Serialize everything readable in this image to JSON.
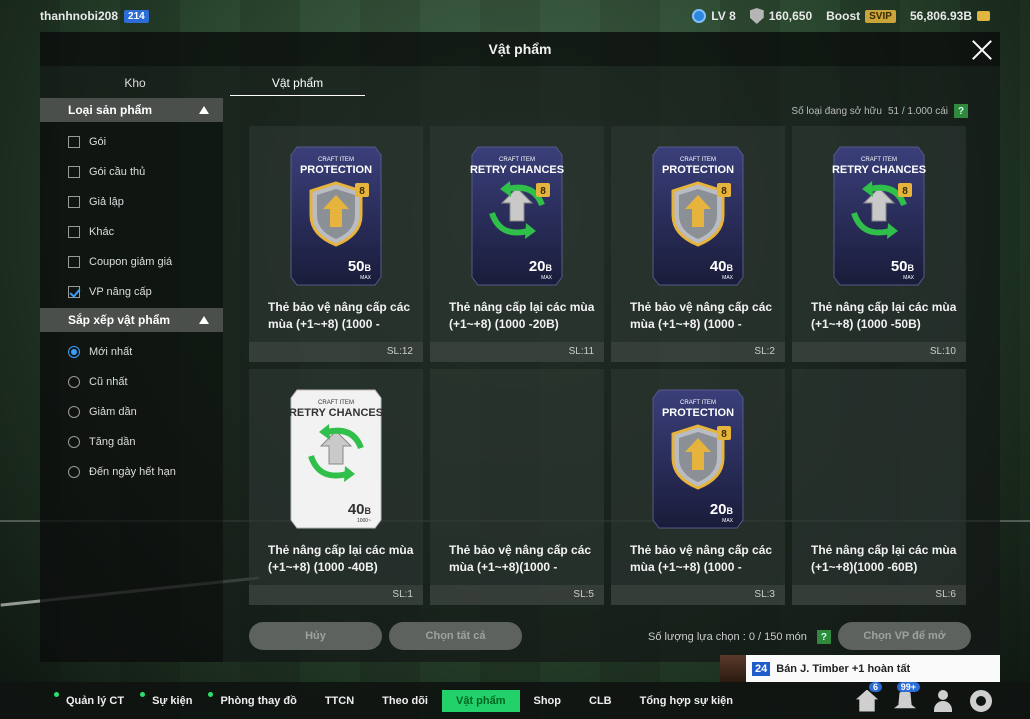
{
  "topbar": {
    "username": "thanhnobi208",
    "user_badge": "214",
    "level": "LV 8",
    "team_value": "160,650",
    "boost_label": "Boost",
    "vip_badge": "SVIP",
    "balance": "56,806.93B"
  },
  "modal": {
    "title": "Vật phẩm",
    "tabs": [
      {
        "label": "Kho",
        "active": false
      },
      {
        "label": "Vật phẩm",
        "active": true
      }
    ]
  },
  "sidebar": {
    "category_header": "Loại sản phẩm",
    "categories": [
      {
        "label": "Gói",
        "checked": false
      },
      {
        "label": "Gói cầu thủ",
        "checked": false
      },
      {
        "label": "Giả lập",
        "checked": false
      },
      {
        "label": "Khác",
        "checked": false
      },
      {
        "label": "Coupon giảm giá",
        "checked": false
      },
      {
        "label": "VP nâng cấp",
        "checked": true
      }
    ],
    "sort_header": "Sắp xếp vật phẩm",
    "sort_options": [
      {
        "label": "Mới nhất",
        "selected": true
      },
      {
        "label": "Cũ nhất",
        "selected": false
      },
      {
        "label": "Giảm dần",
        "selected": false
      },
      {
        "label": "Tăng dần",
        "selected": false
      },
      {
        "label": "Đến ngày hết hạn",
        "selected": false
      }
    ]
  },
  "owned": {
    "label": "Số loại đang sở hữu",
    "value": "51 / 1.000 cái",
    "help": "?"
  },
  "items": [
    {
      "type": "PROTECTION",
      "craft": "CRAFT ITEM",
      "value": "50",
      "unit": "B",
      "sub": "MAX",
      "name": "Thẻ bảo vệ nâng cấp các mùa (+1~+8) (1000 -",
      "qty": "SL:12",
      "style": "dark",
      "level": "8"
    },
    {
      "type": "RETRY CHANCES",
      "craft": "CRAFT ITEM",
      "value": "20",
      "unit": "B",
      "sub": "MAX",
      "name": "Thẻ nâng cấp lại các mùa (+1~+8) (1000 -20B)",
      "qty": "SL:11",
      "style": "dark",
      "level": "8"
    },
    {
      "type": "PROTECTION",
      "craft": "CRAFT ITEM",
      "value": "40",
      "unit": "B",
      "sub": "MAX",
      "name": "Thẻ bảo vệ nâng cấp các mùa (+1~+8) (1000 -",
      "qty": "SL:2",
      "style": "dark",
      "level": "8"
    },
    {
      "type": "RETRY CHANCES",
      "craft": "CRAFT ITEM",
      "value": "50",
      "unit": "B",
      "sub": "MAX",
      "name": "Thẻ nâng cấp lại các mùa (+1~+8) (1000 -50B)",
      "qty": "SL:10",
      "style": "dark",
      "level": "8"
    },
    {
      "type": "RETRY CHANCES",
      "craft": "CRAFT ITEM",
      "value": "40",
      "unit": "B",
      "sub": "1000~",
      "name": "Thẻ nâng cấp lại các mùa (+1~+8) (1000 -40B)",
      "qty": "SL:1",
      "style": "light",
      "level": ""
    },
    {
      "type": "",
      "craft": "",
      "value": "",
      "unit": "",
      "sub": "",
      "name": "Thẻ bảo vệ nâng cấp các mùa (+1~+8)(1000 -",
      "qty": "SL:5",
      "style": "none",
      "level": ""
    },
    {
      "type": "PROTECTION",
      "craft": "CRAFT ITEM",
      "value": "20",
      "unit": "B",
      "sub": "MAX",
      "name": "Thẻ bảo vệ nâng cấp các mùa (+1~+8) (1000 -",
      "qty": "SL:3",
      "style": "dark",
      "level": "8"
    },
    {
      "type": "",
      "craft": "",
      "value": "",
      "unit": "",
      "sub": "",
      "name": "Thẻ nâng cấp lại các mùa (+1~+8)(1000 -60B)",
      "qty": "SL:6",
      "style": "none",
      "level": ""
    }
  ],
  "footer": {
    "cancel_label": "Hủy",
    "select_all_label": "Chọn tất cả",
    "selected_label": "Số lượng lựa chọn : 0 / 150 món",
    "help": "?",
    "open_label": "Chọn VP để mở"
  },
  "toast": {
    "number": "24",
    "text": "Bán J. Timber +1 hoàn tất"
  },
  "bottomnav": {
    "items": [
      {
        "label": "Quản lý CT",
        "dot": true,
        "active": false
      },
      {
        "label": "Sự kiện",
        "dot": true,
        "active": false
      },
      {
        "label": "Phòng thay đồ",
        "dot": true,
        "active": false
      },
      {
        "label": "TTCN",
        "dot": false,
        "active": false
      },
      {
        "label": "Theo dõi",
        "dot": false,
        "active": false
      },
      {
        "label": "Vật phẩm",
        "dot": false,
        "active": true
      },
      {
        "label": "Shop",
        "dot": false,
        "active": false
      },
      {
        "label": "CLB",
        "dot": false,
        "active": false
      },
      {
        "label": "Tổng hợp sự kiện",
        "dot": false,
        "active": false
      }
    ],
    "home_badge": "6",
    "bell_badge": "99+"
  },
  "colors": {
    "accent_green": "#22d16a",
    "card_dark_top": "#3a3f7a",
    "card_dark_bottom": "#1a1c3a",
    "shield_gold": "#e6b43c",
    "retry_green": "#2fbf4a"
  }
}
